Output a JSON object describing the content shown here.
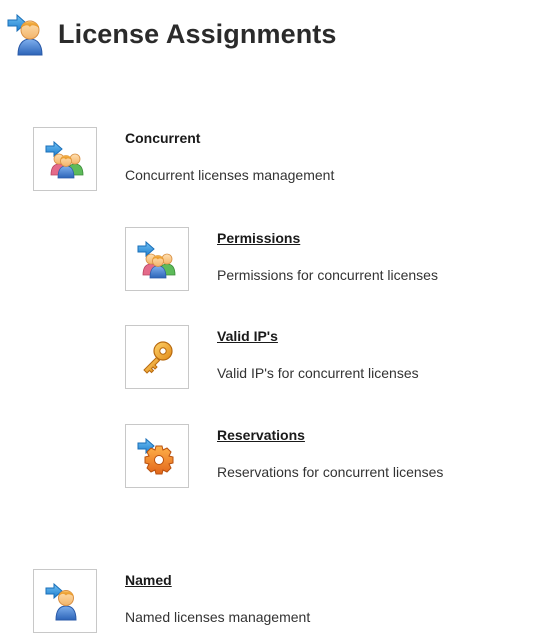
{
  "page": {
    "title": "License Assignments",
    "header_icon": "user-assign-icon"
  },
  "sections": {
    "concurrent": {
      "title": "Concurrent",
      "description": "Concurrent licenses management",
      "icon": "group-assign-icon",
      "is_link": false
    },
    "permissions": {
      "title": "Permissions",
      "description": "Permissions for concurrent licenses",
      "icon": "group-assign-icon",
      "is_link": true
    },
    "valid_ips": {
      "title": "Valid IP's",
      "description": "Valid IP's for concurrent licenses",
      "icon": "key-icon",
      "is_link": true
    },
    "reservations": {
      "title": "Reservations",
      "description": "Reservations for concurrent licenses",
      "icon": "gear-assign-icon",
      "is_link": true
    },
    "named": {
      "title": "Named",
      "description": "Named licenses management",
      "icon": "user-assign-icon",
      "is_link": true
    }
  },
  "colors": {
    "arrow_blue": "#2a8ad6",
    "user_orange": "#f29a2e",
    "user_blue": "#3f7fd0",
    "key_gold": "#f0a028",
    "gear_orange": "#ef7b1a",
    "box_border": "#c8c8c8"
  }
}
